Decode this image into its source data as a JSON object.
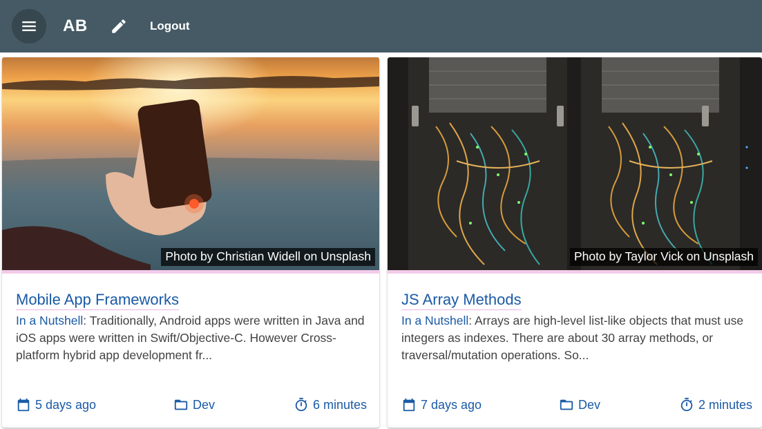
{
  "header": {
    "brand": "AB",
    "logout_label": "Logout",
    "menu_icon": "menu-icon",
    "edit_icon": "pencil-icon",
    "bg_color": "#455a64"
  },
  "posts": [
    {
      "photo_credit": "Photo by Christian Widell on Unsplash",
      "title": "Mobile App Frameworks",
      "nutshell_label": "In a Nutshell",
      "excerpt": ": Traditionally, Android apps were written in Java and iOS apps were written in Swift/Objective-C. However Cross-platform hybrid app development fr...",
      "date": "5 days ago",
      "category": "Dev",
      "read_time": "6 minutes"
    },
    {
      "photo_credit": "Photo by Taylor Vick on Unsplash",
      "title": "JS Array Methods",
      "nutshell_label": "In a Nutshell",
      "excerpt": ": Arrays are high-level list-like objects that must use integers as indexes. There are about 30 array methods, or traversal/mutation operations. So...",
      "date": "7 days ago",
      "category": "Dev",
      "read_time": "2 minutes"
    }
  ],
  "colors": {
    "link": "#1a5aa6",
    "accent_line": "#f3cbe9"
  }
}
